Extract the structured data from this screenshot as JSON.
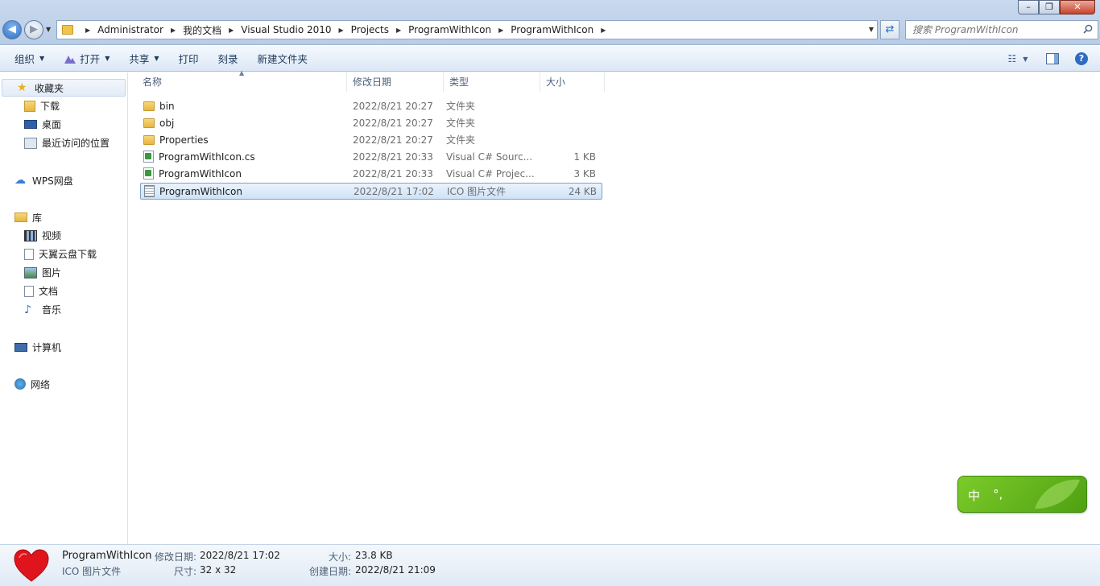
{
  "address_bar": {
    "crumbs": [
      "Administrator",
      "我的文档",
      "Visual Studio 2010",
      "Projects",
      "ProgramWithIcon",
      "ProgramWithIcon"
    ]
  },
  "search": {
    "placeholder": "搜索 ProgramWithIcon"
  },
  "toolbar": {
    "organize": "组织",
    "open": "打开",
    "share": "共享",
    "print": "打印",
    "burn": "刻录",
    "new_folder": "新建文件夹"
  },
  "navpane": {
    "favorites": {
      "label": "收藏夹",
      "items": [
        "下载",
        "桌面",
        "最近访问的位置"
      ]
    },
    "wps": {
      "label": "WPS网盘"
    },
    "libraries": {
      "label": "库",
      "items": [
        "视频",
        "天翼云盘下载",
        "图片",
        "文档",
        "音乐"
      ]
    },
    "computer": {
      "label": "计算机"
    },
    "network": {
      "label": "网络"
    }
  },
  "columns": {
    "name": "名称",
    "date": "修改日期",
    "type": "类型",
    "size": "大小"
  },
  "files": [
    {
      "name": "bin",
      "date": "2022/8/21 20:27",
      "type": "文件夹",
      "size": "",
      "icon": "folder-icon"
    },
    {
      "name": "obj",
      "date": "2022/8/21 20:27",
      "type": "文件夹",
      "size": "",
      "icon": "folder-icon"
    },
    {
      "name": "Properties",
      "date": "2022/8/21 20:27",
      "type": "文件夹",
      "size": "",
      "icon": "folder-icon"
    },
    {
      "name": "ProgramWithIcon.cs",
      "date": "2022/8/21 20:33",
      "type": "Visual C# Sourc...",
      "size": "1 KB",
      "icon": "csharp-file-icon"
    },
    {
      "name": "ProgramWithIcon",
      "date": "2022/8/21 20:33",
      "type": "Visual C# Projec...",
      "size": "3 KB",
      "icon": "csharp-project-icon"
    },
    {
      "name": "ProgramWithIcon",
      "date": "2022/8/21 17:02",
      "type": "ICO 图片文件",
      "size": "24 KB",
      "icon": "ico-file-icon",
      "selected": true
    }
  ],
  "details": {
    "name": "ProgramWithIcon",
    "type": "ICO 图片文件",
    "modified_label": "修改日期:",
    "modified_value": "2022/8/21 17:02",
    "dimensions_label": "尺寸:",
    "dimensions_value": "32 x 32",
    "size_label": "大小:",
    "size_value": "23.8 KB",
    "created_label": "创建日期:",
    "created_value": "2022/8/21 21:09"
  },
  "ime": {
    "mode": "中",
    "punct": "°,"
  },
  "colors": {
    "selection": "#cfe2f8",
    "toolbar_text": "#1e395b",
    "ime_green": "#6cbb22"
  }
}
